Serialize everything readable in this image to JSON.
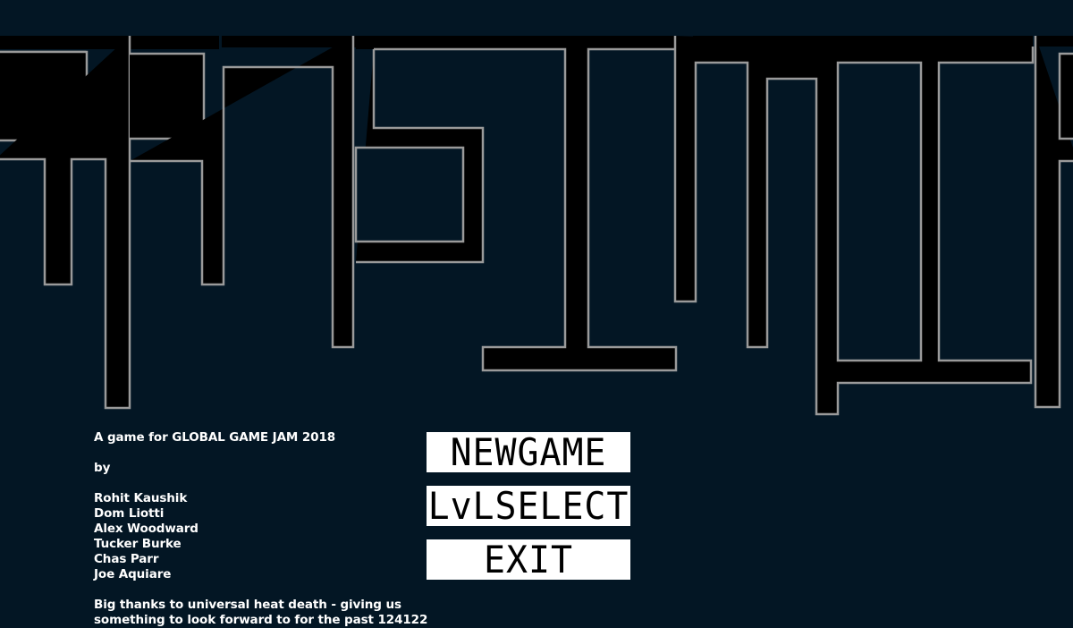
{
  "title_art": {
    "label": "TRANSLUNAR"
  },
  "credits": {
    "line1": "A game for GLOBAL GAME JAM 2018",
    "by": "by",
    "authors": [
      "Rohit Kaushik",
      "Dom Liotti",
      "Alex Woodward",
      "Tucker Burke",
      "Chas Parr",
      "Joe Aquiare"
    ],
    "thanks_1": "Big thanks to universal heat death - giving us",
    "thanks_2": "something to look forward to for the past 124122"
  },
  "menu": {
    "new_game": "NEWGAME",
    "lvl_select": "LvLSELECT",
    "exit": "EXIT"
  },
  "colors": {
    "background": "#031624",
    "block_fill": "#000000",
    "block_outline": "#9a9a9a",
    "button_bg": "#ffffff",
    "button_text": "#000000"
  }
}
